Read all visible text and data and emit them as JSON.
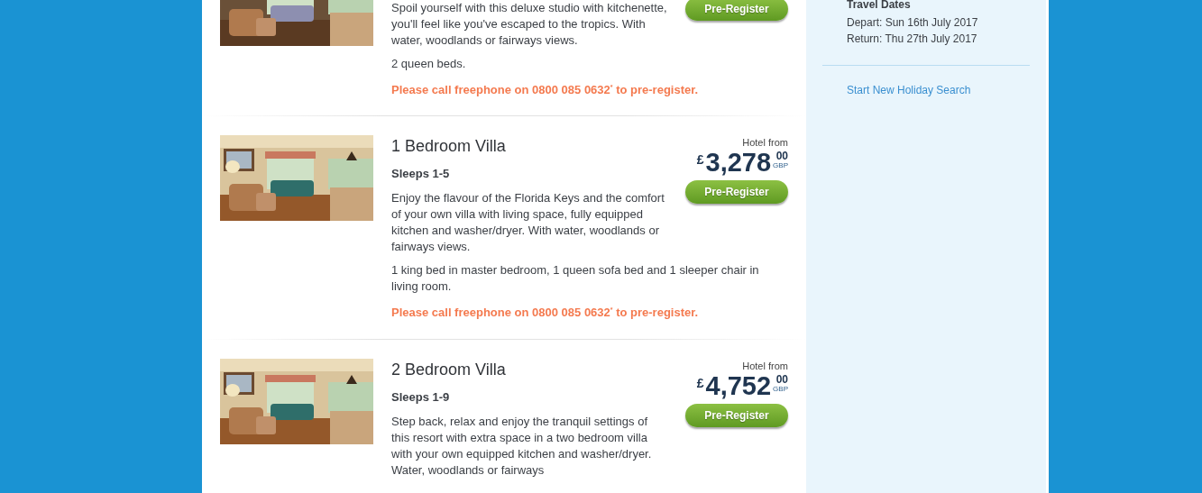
{
  "rooms": [
    {
      "kind": "partial",
      "description": "Spoil yourself with this deluxe studio with kitchenette, you'll feel like you've escaped to the tropics. With water, woodlands or fairways views.",
      "beds": "2 queen beds.",
      "note": "Please call freephone on 0800 085 0632$^{*}$ to pre-register.",
      "button": "Pre-Register"
    },
    {
      "kind": "full",
      "title": "1 Bedroom Villa",
      "sleeps": "Sleeps 1-5",
      "price": {
        "label": "Hotel from",
        "currency": "£",
        "amount": "3,278",
        "pence": "00",
        "code": "GBP"
      },
      "button": "Pre-Register",
      "description": "Enjoy the flavour of the Florida Keys and the comfort of your own villa with living space, fully equipped kitchen and washer/dryer. With water, woodlands or fairways views.",
      "beds": "1 king bed in master bedroom, 1 queen sofa bed and 1 sleeper chair in living room.",
      "note": "Please call freephone on 0800 085 0632$^{*}$ to pre-register."
    },
    {
      "kind": "full",
      "title": "2 Bedroom Villa",
      "sleeps": "Sleeps 1-9",
      "price": {
        "label": "Hotel from",
        "currency": "£",
        "amount": "4,752",
        "pence": "00",
        "code": "GBP"
      },
      "button": "Pre-Register",
      "description": "Step back, relax and enjoy the tranquil settings of this resort with extra space in a two bedroom villa with your own equipped kitchen and washer/dryer. Water, woodlands or fairways"
    }
  ],
  "sidebar": {
    "heading": "Travel Dates",
    "dates": [
      "Depart: Sun 16th July 2017",
      "Return: Thu 27th July 2017"
    ],
    "link": "Start New Holiday Search"
  }
}
